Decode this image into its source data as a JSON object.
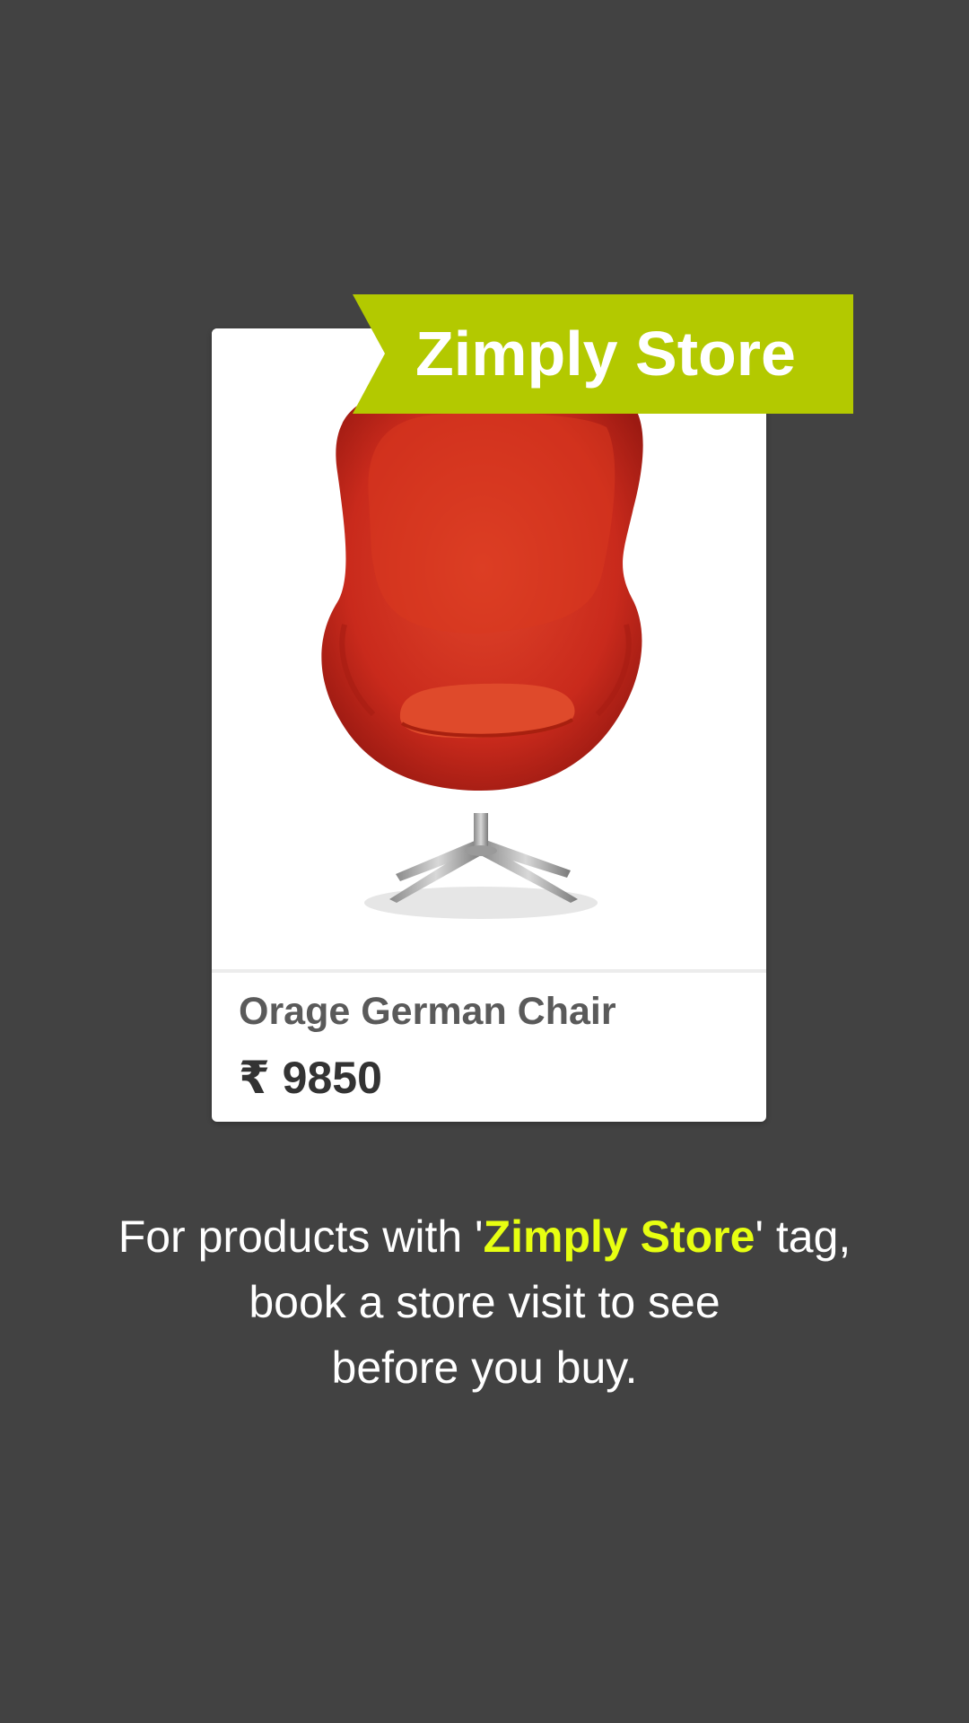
{
  "ribbon": {
    "label": "Zimply Store",
    "color": "#b3c900"
  },
  "product": {
    "image_icon": "red-egg-chair-image",
    "name": "Orage German Chair",
    "price": "₹ 9850"
  },
  "caption": {
    "part1": "For products with '",
    "highlight": "Zimply Store",
    "part2": "' tag,",
    "line2": "book a store visit to see",
    "line3": "before you buy.",
    "highlight_color": "#e7ff11"
  }
}
